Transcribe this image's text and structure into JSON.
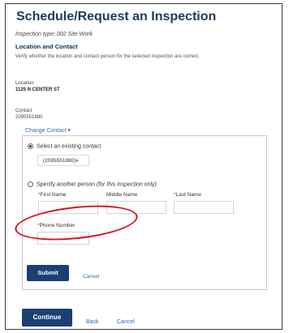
{
  "page": {
    "title": "Schedule/Request an Inspection",
    "inspection_type": "Inspection type: 002 Site Work",
    "section_heading": "Location and Contact",
    "instructions": "Verify whether the location and contact person for the selected inspection are correct."
  },
  "location": {
    "label": "Location",
    "value": "1125 N CENTER ST"
  },
  "contact": {
    "label": "Contact",
    "value": "2095551880",
    "change_link": "Change Contact",
    "change_caret": "▾"
  },
  "contact_panel": {
    "existing_option": {
      "label": "Select an existing contact",
      "selected": true
    },
    "existing_select": {
      "value": "(2095551880)",
      "caret": "▾"
    },
    "another_option": {
      "label": "Specify another person",
      "hint": "(for this inspection only)",
      "selected": false
    },
    "fields": {
      "first_name": "First Name",
      "middle_name": "Middle Name",
      "last_name": "Last Name",
      "phone_number": "Phone Number",
      "required_mark": "*"
    },
    "submit_label": "Submit",
    "cancel_label": "Cancel"
  },
  "footer": {
    "continue_label": "Continue",
    "back_label": "Back",
    "cancel_label": "Cancel"
  },
  "colors": {
    "title": "#1f3b5c",
    "primary_button": "#1a3f73",
    "link": "#2b6cb0",
    "annotation": "#d6141e"
  }
}
